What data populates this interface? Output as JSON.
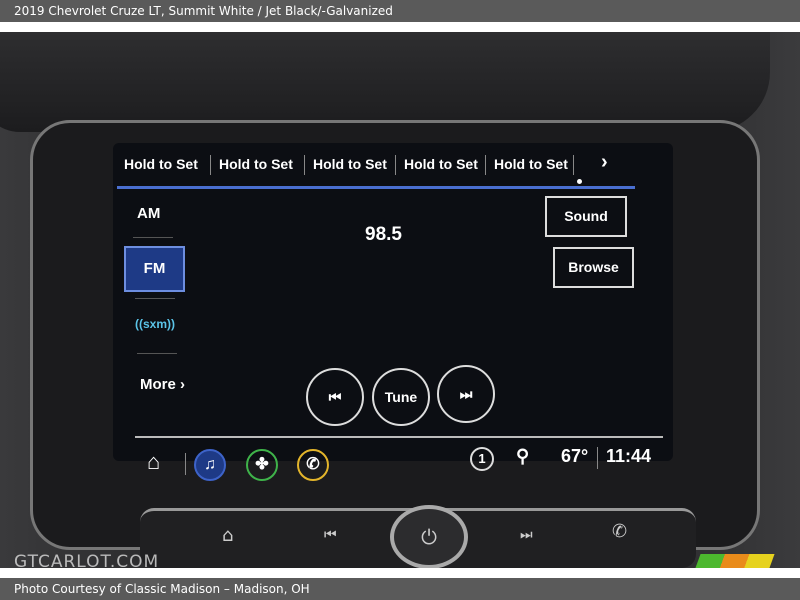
{
  "header": {
    "title": "2019 Chevrolet Cruze LT,  Summit White / Jet Black/-Galvanized"
  },
  "footer": {
    "credit": "Photo Courtesy of Classic Madison – Madison, OH"
  },
  "watermark": "GTCARLOT.COM",
  "radio": {
    "presets": [
      "Hold to Set",
      "Hold to Set",
      "Hold to Set",
      "Hold to Set",
      "Hold to Set"
    ],
    "next_icon": "chevron-right-icon",
    "sources": [
      {
        "label": "AM",
        "selected": false
      },
      {
        "label": "FM",
        "selected": true
      },
      {
        "label": "((sxm))",
        "selected": false
      },
      {
        "label": "More ›",
        "selected": false
      }
    ],
    "frequency": "98.5",
    "sound_label": "Sound",
    "browse_label": "Browse",
    "seek_back_icon": "seek-back-icon",
    "tune_label": "Tune",
    "seek_forward_icon": "seek-forward-icon"
  },
  "status": {
    "notification_count": "1",
    "temperature": "67°",
    "time": "11:44"
  },
  "colors": {
    "accent": "#4a6fd0",
    "music": "#3d63c9",
    "climate": "#3fb34a",
    "phone": "#e3b52b"
  }
}
